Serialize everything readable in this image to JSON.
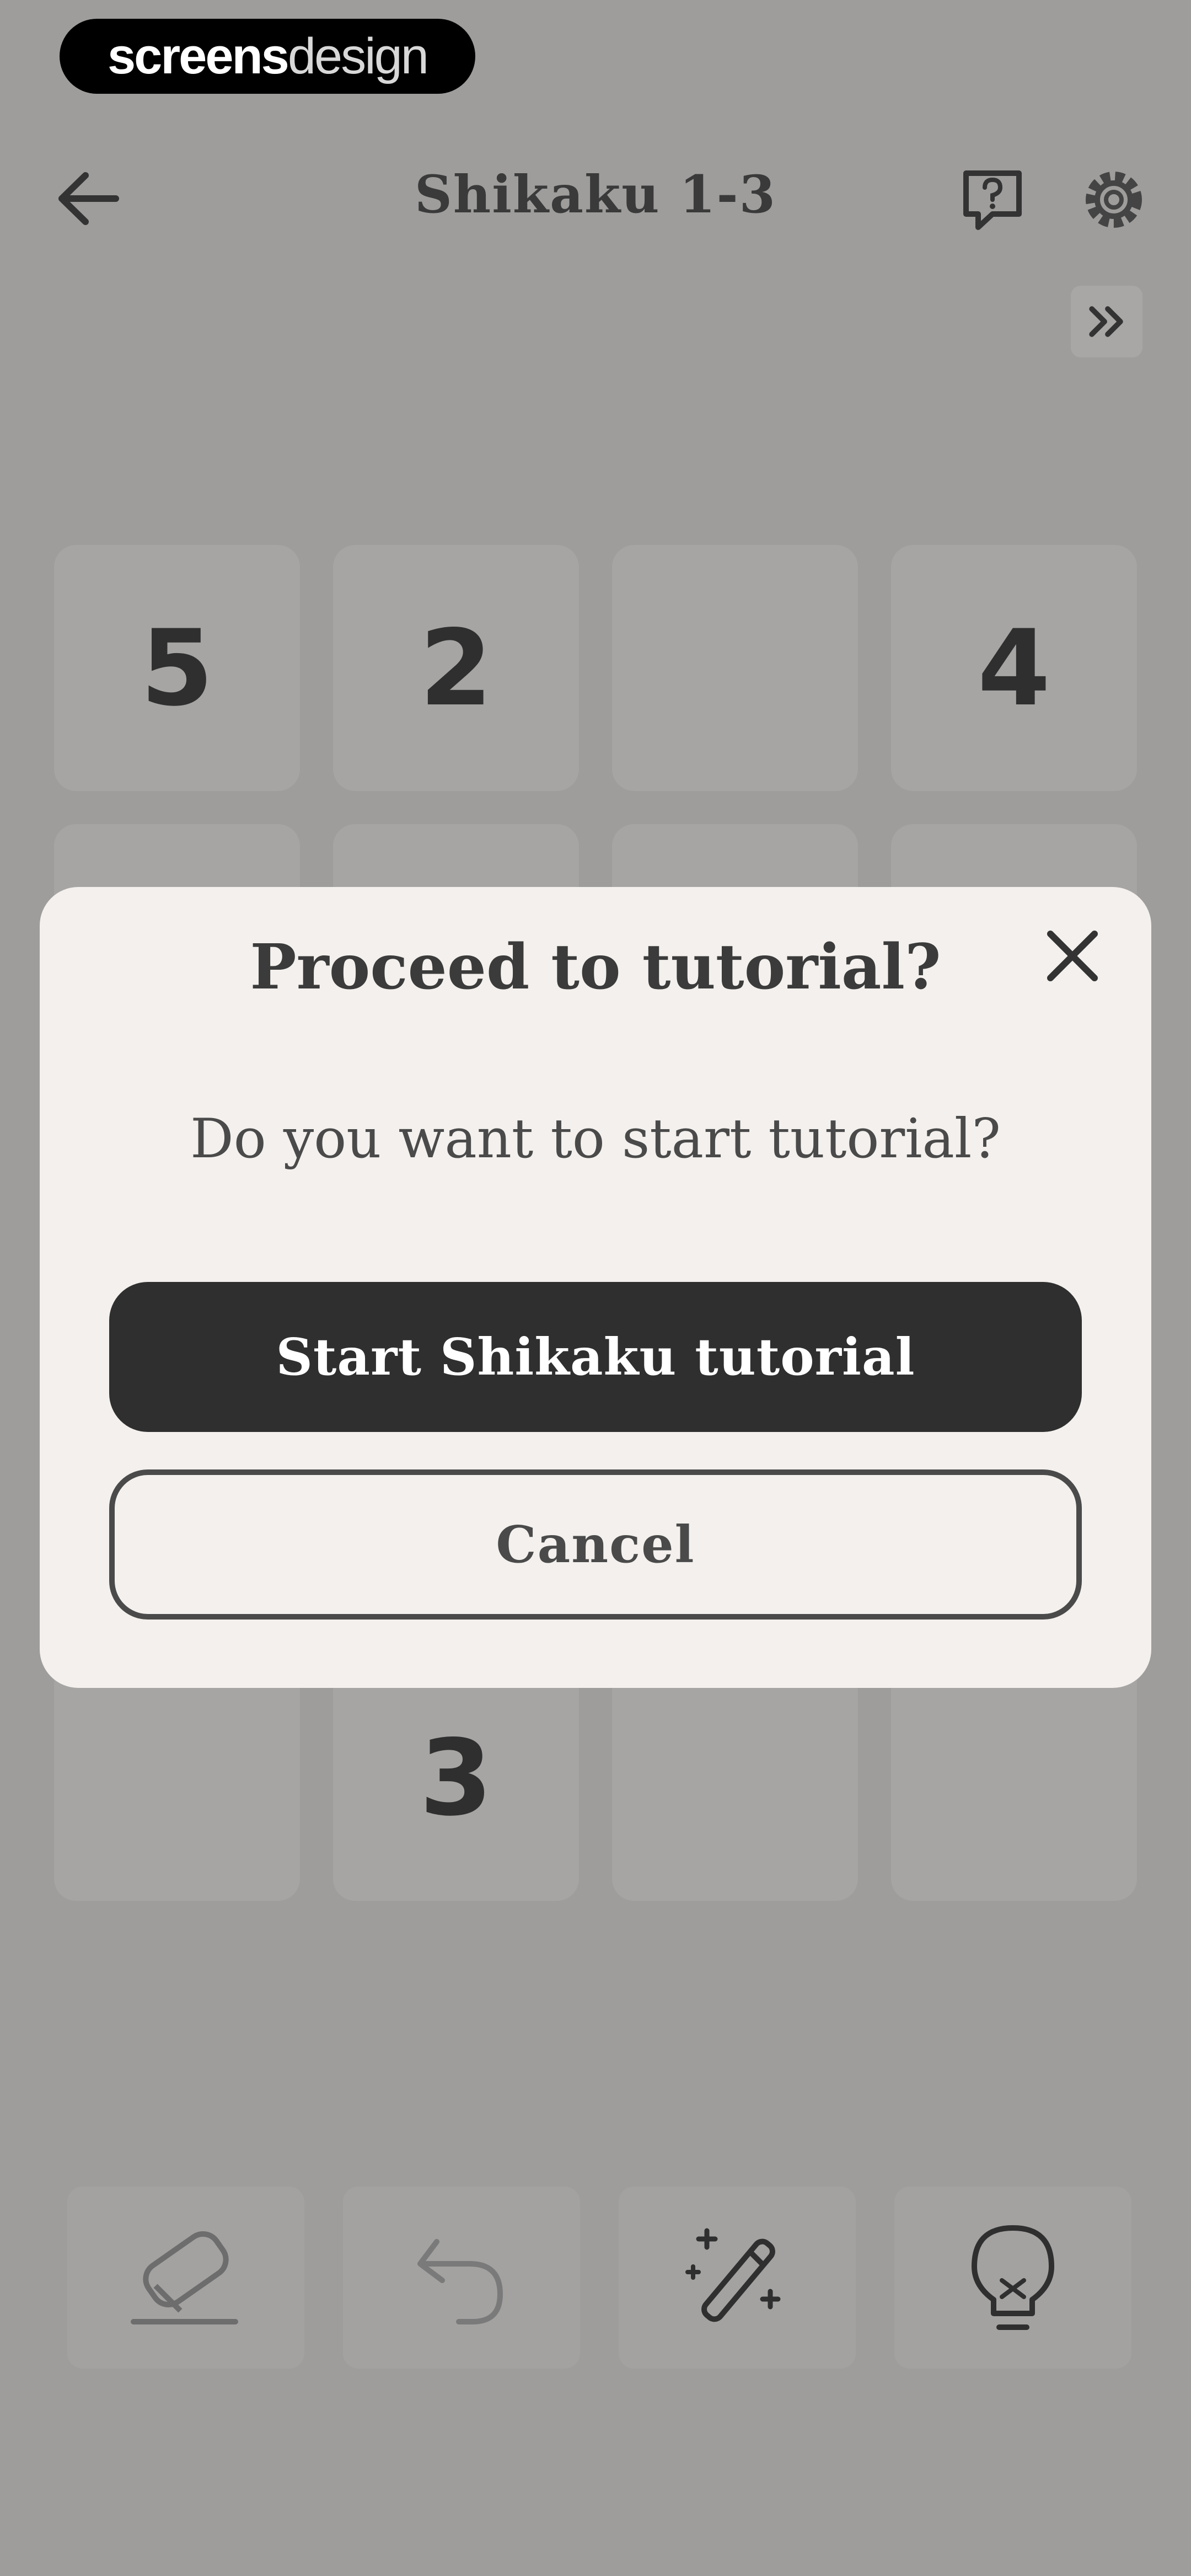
{
  "watermark": {
    "bold": "screens",
    "light": "design"
  },
  "header": {
    "title": "Shikaku 1-3",
    "back_icon": "arrow-left-icon",
    "help_icon": "question-speech-bubble-icon",
    "settings_icon": "gear-icon",
    "skip_icon": "double-chevron-right-icon"
  },
  "grid": {
    "row1": [
      "5",
      "2",
      "",
      "4"
    ],
    "row2": [
      "",
      "",
      "",
      ""
    ],
    "row5": [
      "",
      "3",
      "",
      ""
    ]
  },
  "toolbar": {
    "eraser_icon": "eraser-icon",
    "undo_icon": "undo-icon",
    "magic_icon": "magic-wand-icon",
    "hint_icon": "lightbulb-icon"
  },
  "modal": {
    "title": "Proceed to tutorial?",
    "body": "Do you want to start tutorial?",
    "primary_label": "Start Shikaku tutorial",
    "secondary_label": "Cancel",
    "close_icon": "close-icon"
  },
  "colors": {
    "overlay": "#9e9d9c",
    "modal_bg": "#f3f0ed",
    "primary_button": "#2f2f2f"
  }
}
